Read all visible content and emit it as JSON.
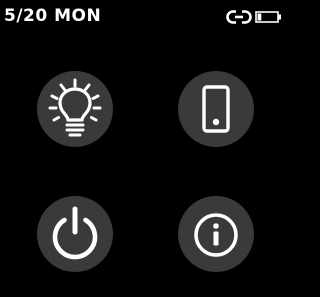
{
  "status_bar": {
    "date_text": "5/20 MON",
    "link_icon": "link-icon",
    "battery_icon": "battery-icon",
    "battery_level": 0.2
  },
  "menu": {
    "items": [
      {
        "icon": "lightbulb-icon"
      },
      {
        "icon": "phone-device-icon"
      },
      {
        "icon": "power-icon"
      },
      {
        "icon": "info-icon"
      }
    ]
  },
  "colors": {
    "background": "#000000",
    "button_fill": "#3a3a3a",
    "foreground": "#ffffff"
  }
}
